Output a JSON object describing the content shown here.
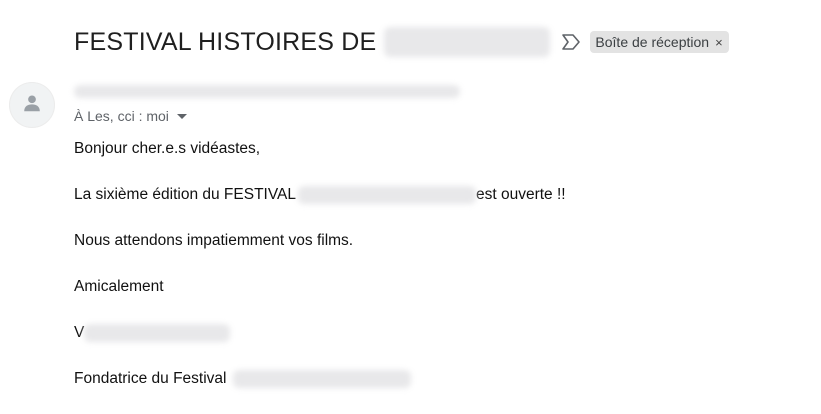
{
  "subject": {
    "text": "FESTIVAL HISTOIRES DE",
    "label_chip": "Boîte de réception",
    "chip_close": "×"
  },
  "header": {
    "recipients": "À Les, cci : moi"
  },
  "message": {
    "greeting": "Bonjour cher.e.s vidéastes,",
    "line1_prefix": "La sixième édition du FESTIVAL",
    "line1_suffix": " est ouverte !!",
    "line2": "Nous attendons impatiemment vos films.",
    "closing": "Amicalement",
    "signature_initial": "V",
    "signature_role": "Fondatrice du Festival"
  },
  "icons": {
    "avatar": "person-icon",
    "important": "important-marker-icon",
    "details": "caret-down-icon"
  },
  "colors": {
    "chip_bg": "#e3e3e3",
    "avatar_bg": "#f1f3f4",
    "text_primary": "#202124",
    "text_secondary": "#5f6368"
  }
}
